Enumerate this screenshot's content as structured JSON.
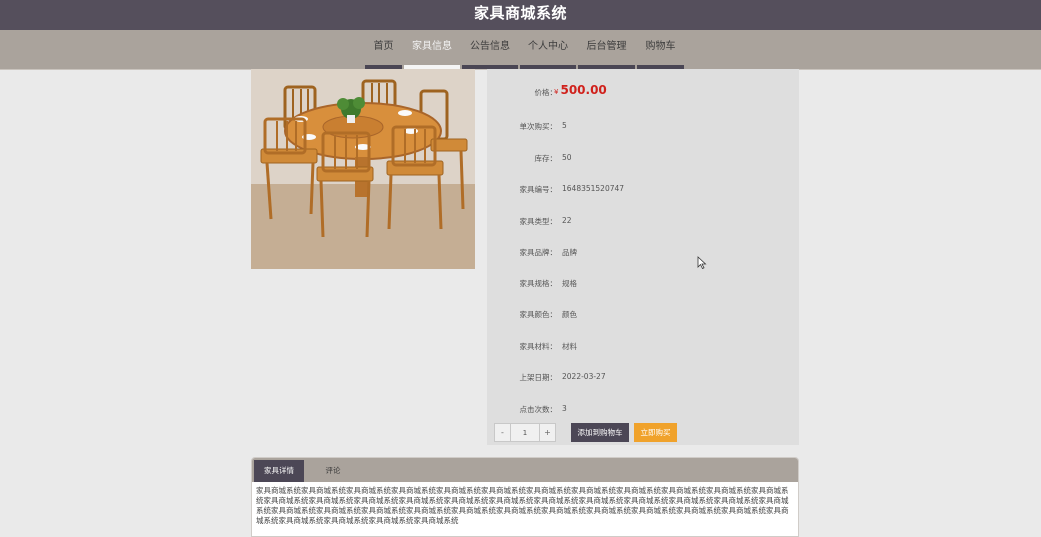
{
  "header": {
    "title": "家具商城系统"
  },
  "nav": {
    "items": [
      {
        "label": "首页",
        "active": false
      },
      {
        "label": "家具信息",
        "active": true
      },
      {
        "label": "公告信息",
        "active": false
      },
      {
        "label": "个人中心",
        "active": false
      },
      {
        "label": "后台管理",
        "active": false
      },
      {
        "label": "购物车",
        "active": false
      }
    ]
  },
  "product": {
    "image_icon": "round-dining-table-with-chairs-photo",
    "price_label": "价格：",
    "currency": "¥",
    "price": "500.00",
    "fields": [
      {
        "label": "单次购买：",
        "value": "5"
      },
      {
        "label": "库存：",
        "value": "50"
      },
      {
        "label": "家具编号：",
        "value": "1648351520747"
      },
      {
        "label": "家具类型：",
        "value": "22"
      },
      {
        "label": "家具品牌：",
        "value": "品牌"
      },
      {
        "label": "家具规格：",
        "value": "规格"
      },
      {
        "label": "家具颜色：",
        "value": "颜色"
      },
      {
        "label": "家具材料：",
        "value": "材料"
      },
      {
        "label": "上架日期：",
        "value": "2022-03-27"
      },
      {
        "label": "点击次数：",
        "value": "3"
      }
    ]
  },
  "purchase": {
    "minus": "-",
    "quantity": "1",
    "plus": "+",
    "add_to_cart": "添加到购物车",
    "buy_now": "立即购买"
  },
  "tabs": {
    "details_label": "家具详情",
    "reviews_label": "评论",
    "details_text": "家具商城系统家具商城系统家具商城系统家具商城系统家具商城系统家具商城系统家具商城系统家具商城系统家具商城系统家具商城系统家具商城系统家具商城系统家具商城系统家具商城系统家具商城系统家具商城系统家具商城系统家具商城系统家具商城系统家具商城系统家具商城系统家具商城系统家具商城系统家具商城系统家具商城系统家具商城系统家具商城系统家具商城系统家具商城系统家具商城系统家具商城系统家具商城系统家具商城系统家具商城系统家具商城系统家具商城系统家具商城系统家具商城系统家具商城系统家具商城系统"
  },
  "colors": {
    "header_bg": "#554f5c",
    "nav_bg": "#aaa39c",
    "price": "#d0211c",
    "cart_button": "#4c4756",
    "buy_button": "#f0a22b"
  }
}
